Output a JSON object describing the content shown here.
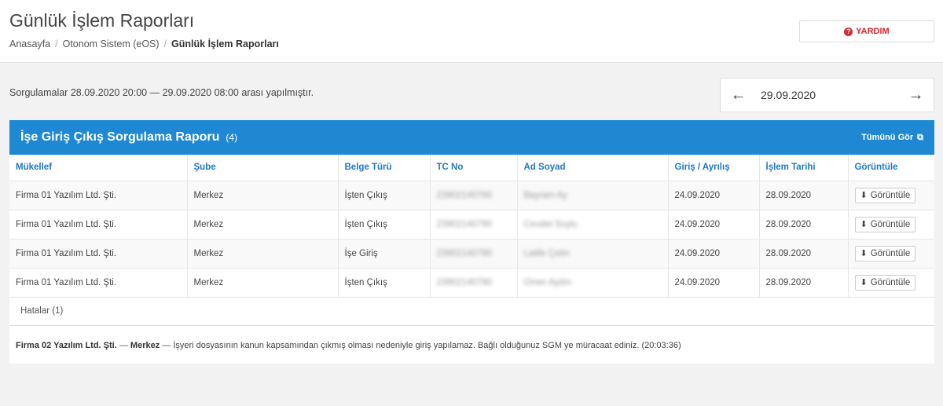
{
  "header": {
    "title": "Günlük İşlem Raporları",
    "breadcrumb": [
      "Anasayfa",
      "Otonom Sistem (eOS)",
      "Günlük İşlem Raporları"
    ],
    "help_label": "YARDIM"
  },
  "query": {
    "info": "Sorgulamalar 28.09.2020 20:00 — 29.09.2020 08:00 arası yapılmıştır.",
    "date": "29.09.2020"
  },
  "panel": {
    "title": "İşe Giriş Çıkış Sorgulama Raporu",
    "count": "(4)",
    "see_all": "Tümünü Gör",
    "columns": [
      "Mükellef",
      "Şube",
      "Belge Türü",
      "TC No",
      "Ad Soyad",
      "Giriş / Ayrılış",
      "İşlem Tarihi",
      "Görüntüle"
    ],
    "rows": [
      {
        "company": "Firma 01 Yazılım Ltd. Şti.",
        "branch": "Merkez",
        "doc_type": "İşten Çıkış",
        "tc": "23902140790",
        "name": "Bayram Ay",
        "io_date": "24.09.2020",
        "txn_date": "28.09.2020",
        "view": "Görüntüle"
      },
      {
        "company": "Firma 01 Yazılım Ltd. Şti.",
        "branch": "Merkez",
        "doc_type": "İşten Çıkış",
        "tc": "23902140790",
        "name": "Cevdet Soylu",
        "io_date": "24.09.2020",
        "txn_date": "28.09.2020",
        "view": "Görüntüle"
      },
      {
        "company": "Firma 01 Yazılım Ltd. Şti.",
        "branch": "Merkez",
        "doc_type": "İşe Giriş",
        "tc": "23902140790",
        "name": "Latife Çetin",
        "io_date": "24.09.2020",
        "txn_date": "28.09.2020",
        "view": "Görüntüle"
      },
      {
        "company": "Firma 01 Yazılım Ltd. Şti.",
        "branch": "Merkez",
        "doc_type": "İşten Çıkış",
        "tc": "23902140790",
        "name": "Ömer Aydın",
        "io_date": "24.09.2020",
        "txn_date": "28.09.2020",
        "view": "Görüntüle"
      }
    ],
    "errors_label": "Hatalar (1)",
    "error": {
      "company": "Firma 02 Yazılım Ltd. Şti.",
      "dash1": " — ",
      "branch": "Merkez",
      "dash2": " — ",
      "message": "İşyeri dosyasının kanun kapsamından çıkmış olması nedeniyle giriş yapılamaz. Bağlı olduğunuz SGM ye müracaat ediniz. (20:03:36)"
    }
  },
  "icons": {
    "help": "question-circle-icon",
    "prev": "arrow-left-icon",
    "next": "arrow-right-icon",
    "external": "external-link-icon",
    "download": "download-icon"
  },
  "colors": {
    "accent": "#1e88d3",
    "header_text": "#1e78c6",
    "help": "#d9262e"
  }
}
